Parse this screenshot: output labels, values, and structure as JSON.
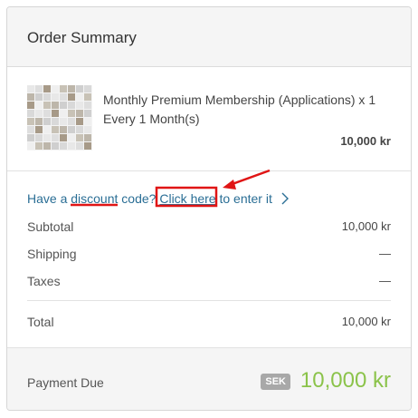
{
  "order_summary": {
    "title": "Order Summary",
    "item": {
      "name": "Monthly Premium Membership (Applications) x 1",
      "cycle": "Every 1 Month(s)",
      "price": "10,000 kr"
    },
    "discount": {
      "prefix": "Have a",
      "discount_word": "discount",
      "mid": " code?",
      "link_label": "Click here",
      "suffix": " to enter it",
      "chevron_icon": "chevron-right-icon"
    },
    "lines": [
      {
        "label": "Subtotal",
        "value": "10,000 kr"
      },
      {
        "label": "Shipping",
        "value": "—"
      },
      {
        "label": "Taxes",
        "value": "—"
      }
    ],
    "total": {
      "label": "Total",
      "value": "10,000 kr"
    },
    "payment_due": {
      "label": "Payment Due",
      "currency": "SEK",
      "amount": "10,000 kr"
    }
  },
  "colors": {
    "link": "#2a6e95",
    "due_amount": "#8bc34a",
    "annotation": "#e01515"
  }
}
